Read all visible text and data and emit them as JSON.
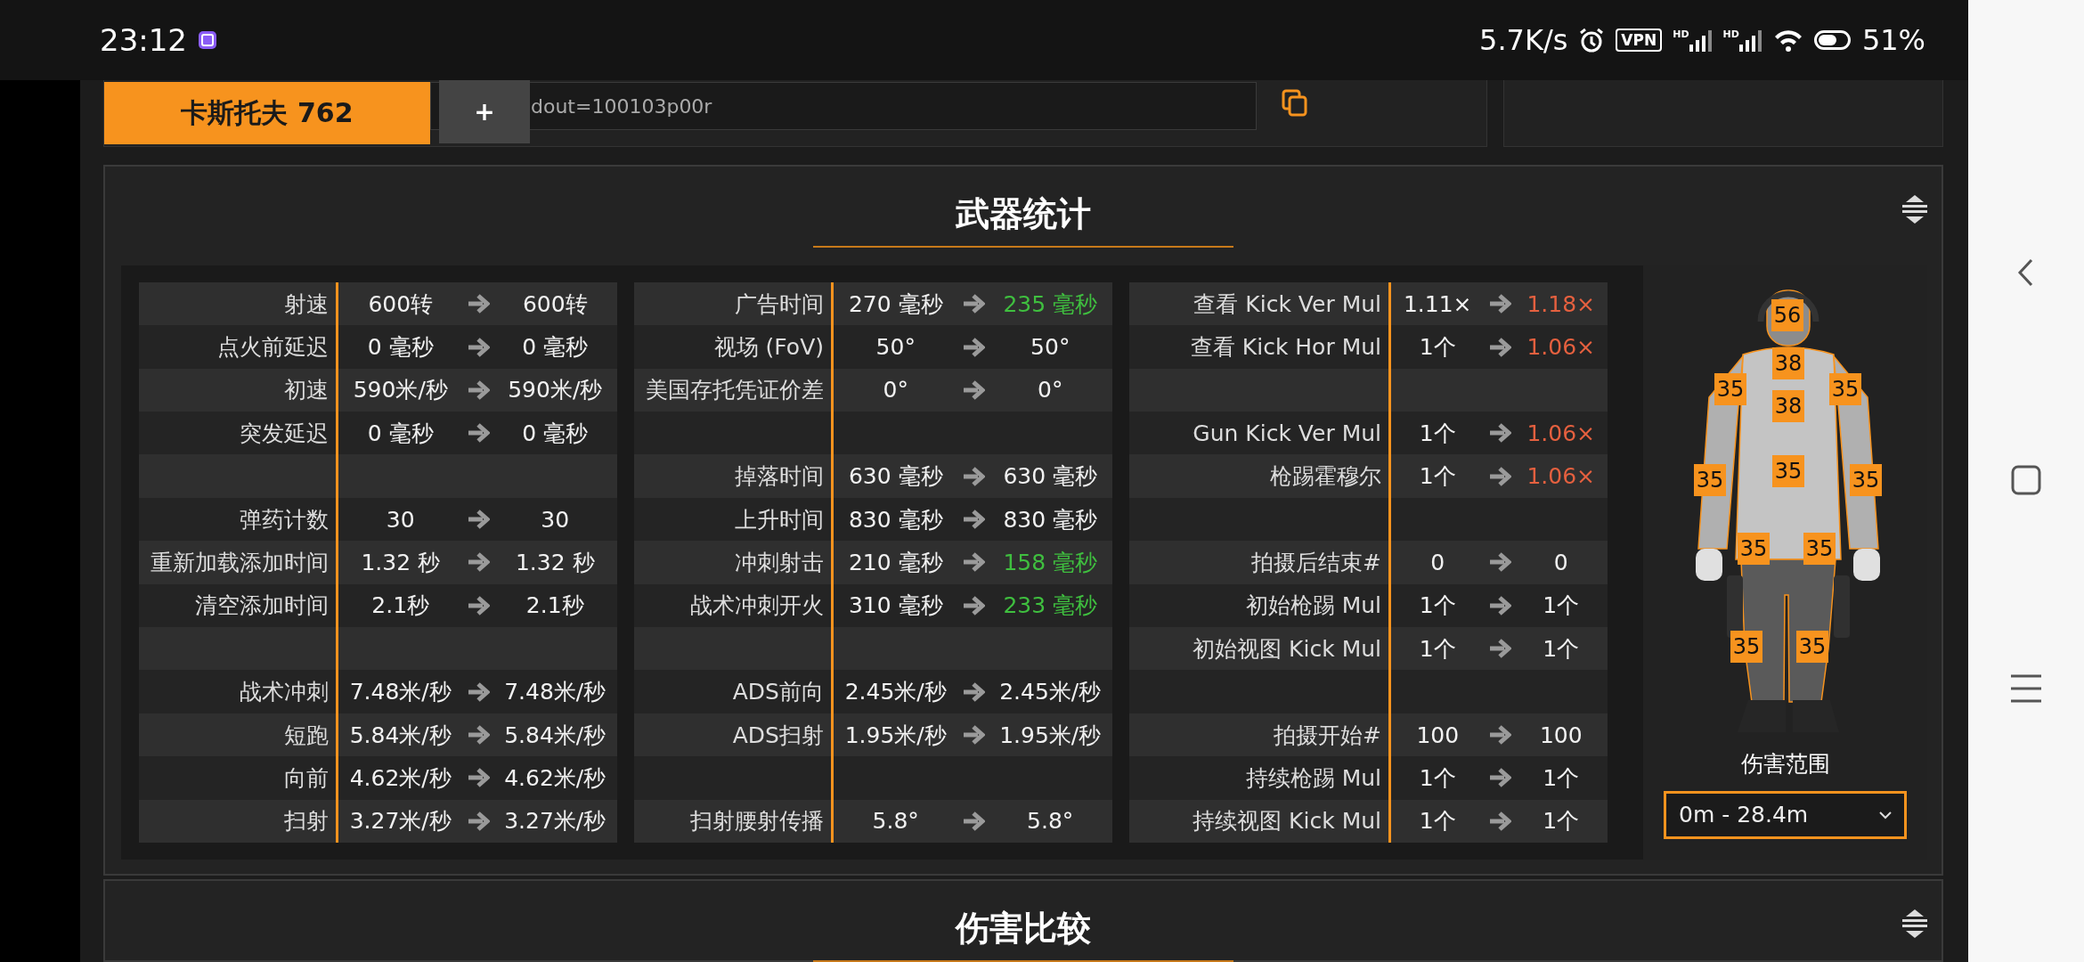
{
  "status_bar": {
    "time": "23:12",
    "net_speed": "5.7K/s",
    "vpn": "VPN",
    "signal_labels": [
      "HD",
      "HD"
    ],
    "battery": "51%"
  },
  "top_bar": {
    "weapon_button": "卡斯托夫 762",
    "add_button": "+",
    "share_field": {
      "value": "dout=100103p00r"
    }
  },
  "weapon_stats": {
    "title": "武器统计",
    "tables": [
      {
        "rows": [
          {
            "kind": "stat",
            "label": "射速",
            "before": "600转",
            "after": "600转",
            "better": false,
            "worse": false
          },
          {
            "kind": "stat",
            "label": "点火前延迟",
            "before": "0 毫秒",
            "after": "0 毫秒",
            "better": false,
            "worse": false
          },
          {
            "kind": "stat",
            "label": "初速",
            "before": "590米/秒",
            "after": "590米/秒",
            "better": false,
            "worse": false
          },
          {
            "kind": "stat",
            "label": "突发延迟",
            "before": "0 毫秒",
            "after": "0 毫秒",
            "better": false,
            "worse": false
          },
          {
            "kind": "blank"
          },
          {
            "kind": "stat",
            "label": "弹药计数",
            "before": "30",
            "after": "30",
            "better": false,
            "worse": false
          },
          {
            "kind": "stat",
            "label": "重新加载添加时间",
            "before": "1.32 秒",
            "after": "1.32 秒",
            "better": false,
            "worse": false
          },
          {
            "kind": "stat",
            "label": "清空添加时间",
            "before": "2.1秒",
            "after": "2.1秒",
            "better": false,
            "worse": false
          },
          {
            "kind": "blank"
          },
          {
            "kind": "stat",
            "label": "战术冲刺",
            "before": "7.48米/秒",
            "after": "7.48米/秒",
            "better": false,
            "worse": false
          },
          {
            "kind": "stat",
            "label": "短跑",
            "before": "5.84米/秒",
            "after": "5.84米/秒",
            "better": false,
            "worse": false
          },
          {
            "kind": "stat",
            "label": "向前",
            "before": "4.62米/秒",
            "after": "4.62米/秒",
            "better": false,
            "worse": false
          },
          {
            "kind": "stat",
            "label": "扫射",
            "before": "3.27米/秒",
            "after": "3.27米/秒",
            "better": false,
            "worse": false
          }
        ]
      },
      {
        "rows": [
          {
            "kind": "stat",
            "label": "广告时间",
            "before": "270 毫秒",
            "after": "235 毫秒",
            "better": true,
            "worse": false
          },
          {
            "kind": "stat",
            "label": "视场 (FoV)",
            "before": "50°",
            "after": "50°",
            "better": false,
            "worse": false
          },
          {
            "kind": "stat",
            "label": "美国存托凭证价差",
            "before": "0°",
            "after": "0°",
            "better": false,
            "worse": false
          },
          {
            "kind": "blank"
          },
          {
            "kind": "stat",
            "label": "掉落时间",
            "before": "630 毫秒",
            "after": "630 毫秒",
            "better": false,
            "worse": false
          },
          {
            "kind": "stat",
            "label": "上升时间",
            "before": "830 毫秒",
            "after": "830 毫秒",
            "better": false,
            "worse": false
          },
          {
            "kind": "stat",
            "label": "冲刺射击",
            "before": "210 毫秒",
            "after": "158 毫秒",
            "better": true,
            "worse": false
          },
          {
            "kind": "stat",
            "label": "战术冲刺开火",
            "before": "310 毫秒",
            "after": "233 毫秒",
            "better": true,
            "worse": false
          },
          {
            "kind": "blank"
          },
          {
            "kind": "stat",
            "label": "ADS前向",
            "before": "2.45米/秒",
            "after": "2.45米/秒",
            "better": false,
            "worse": false
          },
          {
            "kind": "stat",
            "label": "ADS扫射",
            "before": "1.95米/秒",
            "after": "1.95米/秒",
            "better": false,
            "worse": false
          },
          {
            "kind": "blank"
          },
          {
            "kind": "stat",
            "label": "扫射腰射传播",
            "before": "5.8°",
            "after": "5.8°",
            "better": false,
            "worse": false
          }
        ]
      },
      {
        "rows": [
          {
            "kind": "stat",
            "label": "查看 Kick Ver Mul",
            "before": "1.11×",
            "after": "1.18×",
            "better": false,
            "worse": true
          },
          {
            "kind": "stat",
            "label": "查看 Kick Hor Mul",
            "before": "1个",
            "after": "1.06×",
            "better": false,
            "worse": true
          },
          {
            "kind": "blank"
          },
          {
            "kind": "stat",
            "label": "Gun Kick Ver Mul",
            "before": "1个",
            "after": "1.06×",
            "better": false,
            "worse": true
          },
          {
            "kind": "stat",
            "label": "枪踢霍穆尔",
            "before": "1个",
            "after": "1.06×",
            "better": false,
            "worse": true
          },
          {
            "kind": "blank"
          },
          {
            "kind": "stat",
            "label": "拍摄后结束#",
            "before": "0",
            "after": "0",
            "better": false,
            "worse": false
          },
          {
            "kind": "stat",
            "label": "初始枪踢 Mul",
            "before": "1个",
            "after": "1个",
            "better": false,
            "worse": false
          },
          {
            "kind": "stat",
            "label": "初始视图 Kick Mul",
            "before": "1个",
            "after": "1个",
            "better": false,
            "worse": false
          },
          {
            "kind": "blank"
          },
          {
            "kind": "stat",
            "label": "拍摄开始#",
            "before": "100",
            "after": "100",
            "better": false,
            "worse": false
          },
          {
            "kind": "stat",
            "label": "持续枪踢 Mul",
            "before": "1个",
            "after": "1个",
            "better": false,
            "worse": false
          },
          {
            "kind": "stat",
            "label": "持续视图 Kick Mul",
            "before": "1个",
            "after": "1个",
            "better": false,
            "worse": false
          }
        ]
      }
    ],
    "figure": {
      "hit_zones": [
        "56",
        "38",
        "35",
        "35",
        "38",
        "35",
        "35",
        "35",
        "35",
        "35",
        "35",
        "35"
      ],
      "caption": "伤害范围",
      "range_select": {
        "value": "0m - 28.4m"
      }
    }
  },
  "damage_comparison": {
    "title": "伤害比较"
  }
}
